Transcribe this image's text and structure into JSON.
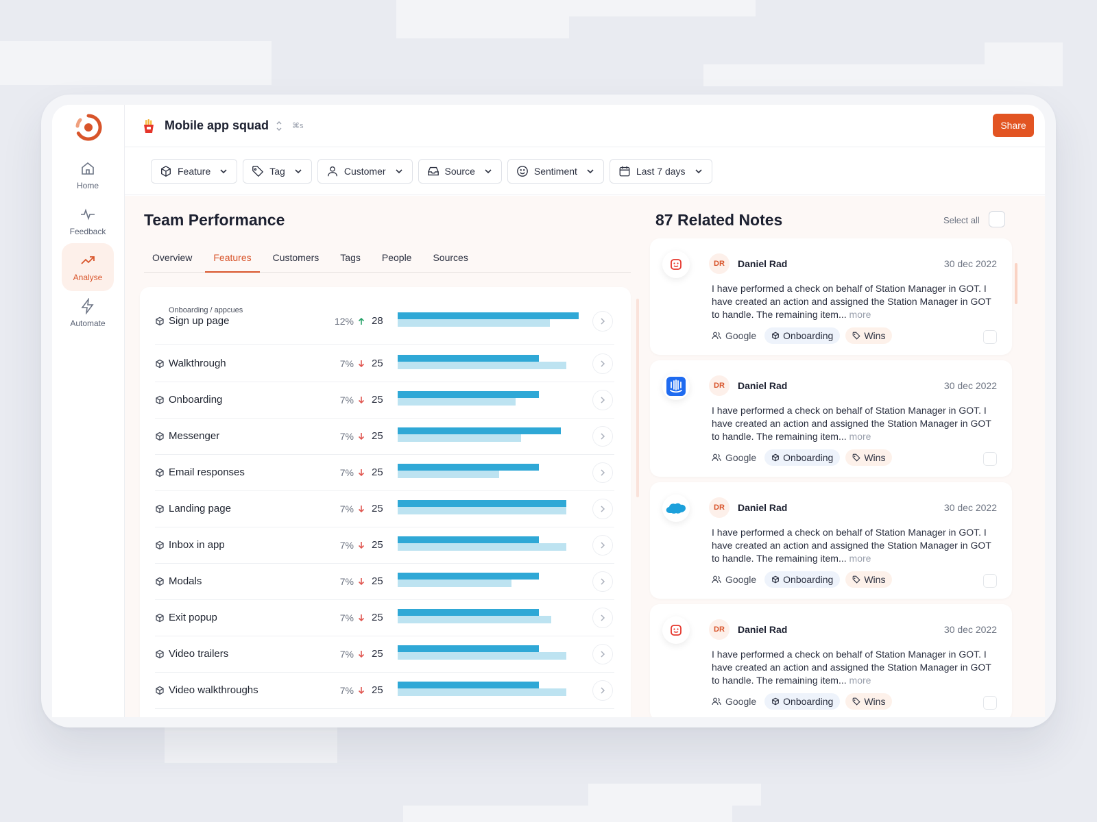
{
  "sidebar": {
    "items": [
      {
        "label": "Home",
        "icon": "home-icon"
      },
      {
        "label": "Feedback",
        "icon": "pulse-icon"
      },
      {
        "label": "Analyse",
        "icon": "trending-up-icon",
        "active": true
      },
      {
        "label": "Automate",
        "icon": "bolt-icon"
      }
    ]
  },
  "header": {
    "title": "Mobile app squad",
    "shortcut": "⌘s",
    "share_label": "Share"
  },
  "filters": [
    "Feature",
    "Tag",
    "Customer",
    "Source",
    "Sentiment",
    "Last 7 days"
  ],
  "performance": {
    "title": "Team Performance",
    "tabs": [
      "Overview",
      "Features",
      "Customers",
      "Tags",
      "People",
      "Sources"
    ],
    "active_tab": "Features",
    "rows": [
      {
        "breadcrumb": "Onboarding / appcues",
        "name": "Sign up page",
        "pct": "12%",
        "trend": "up",
        "count": "28",
        "bar_primary": 1.0,
        "bar_secondary": 0.84
      },
      {
        "name": "Walkthrough",
        "pct": "7%",
        "trend": "down",
        "count": "25",
        "bar_primary": 0.78,
        "bar_secondary": 0.93
      },
      {
        "name": "Onboarding",
        "pct": "7%",
        "trend": "down",
        "count": "25",
        "bar_primary": 0.78,
        "bar_secondary": 0.65
      },
      {
        "name": "Messenger",
        "pct": "7%",
        "trend": "down",
        "count": "25",
        "bar_primary": 0.9,
        "bar_secondary": 0.68
      },
      {
        "name": "Email responses",
        "pct": "7%",
        "trend": "down",
        "count": "25",
        "bar_primary": 0.78,
        "bar_secondary": 0.56
      },
      {
        "name": "Landing page",
        "pct": "7%",
        "trend": "down",
        "count": "25",
        "bar_primary": 0.93,
        "bar_secondary": 0.93
      },
      {
        "name": "Inbox in app",
        "pct": "7%",
        "trend": "down",
        "count": "25",
        "bar_primary": 0.78,
        "bar_secondary": 0.93
      },
      {
        "name": "Modals",
        "pct": "7%",
        "trend": "down",
        "count": "25",
        "bar_primary": 0.78,
        "bar_secondary": 0.63
      },
      {
        "name": "Exit popup",
        "pct": "7%",
        "trend": "down",
        "count": "25",
        "bar_primary": 0.78,
        "bar_secondary": 0.85
      },
      {
        "name": "Video trailers",
        "pct": "7%",
        "trend": "down",
        "count": "25",
        "bar_primary": 0.78,
        "bar_secondary": 0.93
      },
      {
        "name": "Video walkthroughs",
        "pct": "7%",
        "trend": "down",
        "count": "25",
        "bar_primary": 0.78,
        "bar_secondary": 0.93
      }
    ]
  },
  "notes": {
    "title": "87 Related Notes",
    "select_all_label": "Select all",
    "items": [
      {
        "source_icon": "intercom-face-icon",
        "initials": "DR",
        "author": "Daniel Rad",
        "date": "30 dec 2022",
        "text": "I have performed a check on behalf of Station Manager in GOT. I have created an action and assigned the Station Manager in GOT to handle. The remaining item...",
        "more": "more",
        "customer": "Google",
        "feature": "Onboarding",
        "tag": "Wins"
      },
      {
        "source_icon": "intercom-icon",
        "initials": "DR",
        "author": "Daniel Rad",
        "date": "30 dec 2022",
        "text": "I have performed a check on behalf of Station Manager in GOT. I have created an action and assigned the Station Manager in GOT to handle. The remaining item...",
        "more": "more",
        "customer": "Google",
        "feature": "Onboarding",
        "tag": "Wins"
      },
      {
        "source_icon": "salesforce-icon",
        "initials": "DR",
        "author": "Daniel Rad",
        "date": "30 dec 2022",
        "text": "I have performed a check on behalf of Station Manager in GOT. I have created an action and assigned the Station Manager in GOT to handle. The remaining item...",
        "more": "more",
        "customer": "Google",
        "feature": "Onboarding",
        "tag": "Wins"
      },
      {
        "source_icon": "intercom-face-icon",
        "initials": "DR",
        "author": "Daniel Rad",
        "date": "30 dec 2022",
        "text": "I have performed a check on behalf of Station Manager in GOT. I have created an action and assigned the Station Manager in GOT to handle. The remaining item...",
        "more": "more",
        "customer": "Google",
        "feature": "Onboarding",
        "tag": "Wins"
      }
    ]
  },
  "colors": {
    "accent": "#e25422",
    "bar_primary": "#2fa8d6",
    "bar_secondary": "#bde3f1",
    "trend_up": "#26a269",
    "trend_down": "#e0554f"
  }
}
